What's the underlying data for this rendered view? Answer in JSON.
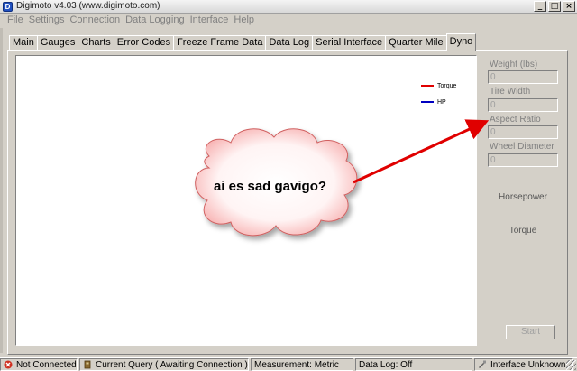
{
  "window": {
    "title": "Digimoto v4.03 (www.digimoto.com)",
    "app_icon": "D",
    "controls": {
      "minimize": "_",
      "maximize": "□",
      "close": "×"
    }
  },
  "menu": [
    "File",
    "Settings",
    "Connection",
    "Data Logging",
    "Interface",
    "Help"
  ],
  "tabs": [
    {
      "label": "Main"
    },
    {
      "label": "Gauges"
    },
    {
      "label": "Charts"
    },
    {
      "label": "Error Codes"
    },
    {
      "label": "Freeze Frame Data"
    },
    {
      "label": "Data Log"
    },
    {
      "label": "Serial Interface"
    },
    {
      "label": "Quarter Mile"
    },
    {
      "label": "Dyno",
      "active": true
    }
  ],
  "chart": {
    "legend": [
      {
        "label": "Torque",
        "color": "#e00000"
      },
      {
        "label": "HP",
        "color": "#0000c0"
      }
    ]
  },
  "side": {
    "weight_label": "Weight (lbs)",
    "weight_value": "0",
    "tire_width_label": "Tire Width",
    "tire_width_value": "0",
    "aspect_ratio_label": "Aspect Ratio",
    "aspect_ratio_value": "0",
    "wheel_diameter_label": "Wheel Diameter",
    "wheel_diameter_value": "0",
    "horsepower_label": "Horsepower",
    "torque_label": "Torque",
    "start_label": "Start"
  },
  "annotation": {
    "text": "ai es sad gavigo?",
    "arrow_color": "#e00000"
  },
  "status": {
    "connection": "Not Connected",
    "query": "Current Query ( Awaiting Connection )",
    "measurement": "Measurement: Metric",
    "data_log": "Data Log: Off",
    "interface": "Interface Unknown"
  }
}
